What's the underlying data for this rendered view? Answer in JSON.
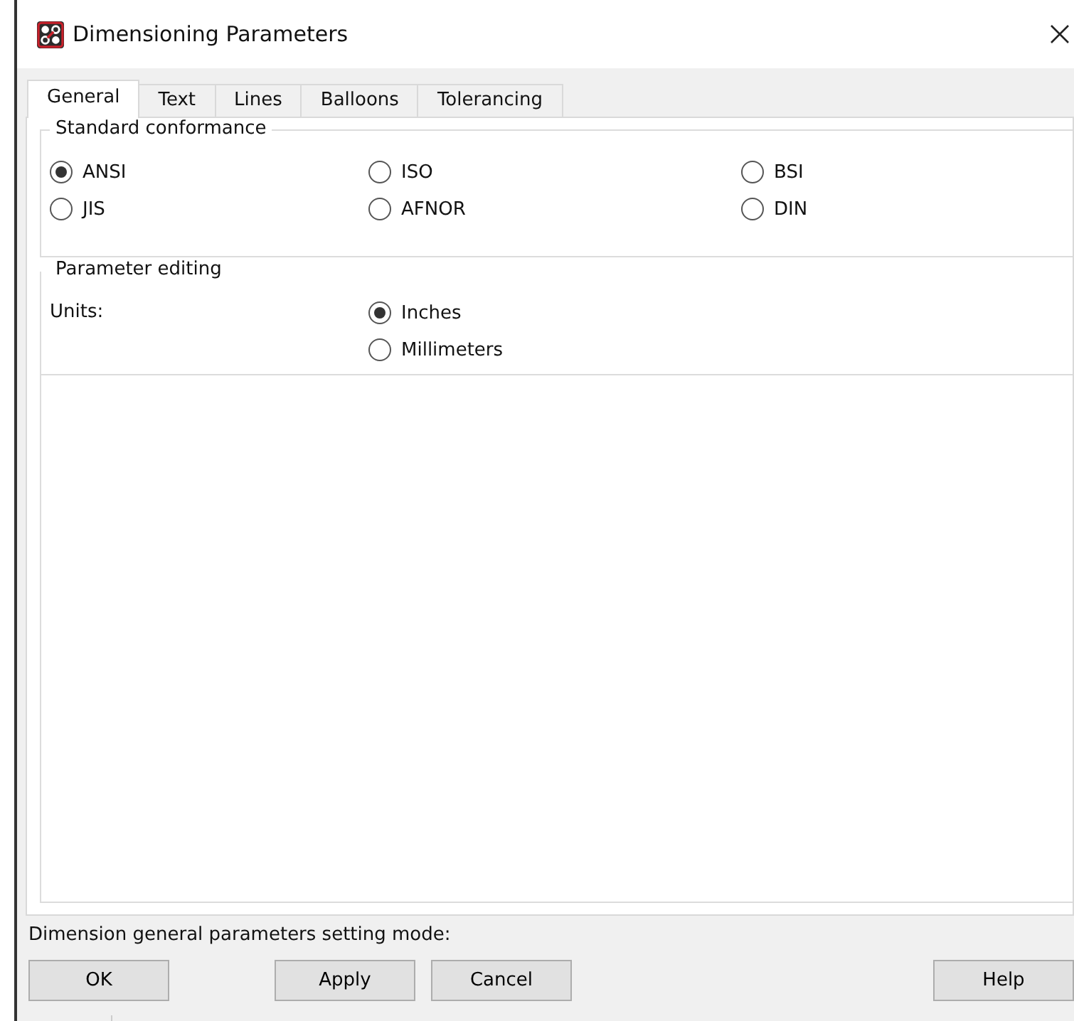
{
  "window": {
    "title": "Dimensioning Parameters"
  },
  "tabs": [
    {
      "label": "General",
      "selected": true
    },
    {
      "label": "Text",
      "selected": false
    },
    {
      "label": "Lines",
      "selected": false
    },
    {
      "label": "Balloons",
      "selected": false
    },
    {
      "label": "Tolerancing",
      "selected": false
    }
  ],
  "groups": [
    {
      "title": "Standard conformance",
      "kind": "grid",
      "options": [
        {
          "label": "ANSI",
          "selected": true
        },
        {
          "label": "ISO",
          "selected": false
        },
        {
          "label": "BSI",
          "selected": false
        },
        {
          "label": "JIS",
          "selected": false
        },
        {
          "label": "AFNOR",
          "selected": false
        },
        {
          "label": "DIN",
          "selected": false
        }
      ]
    },
    {
      "title": "Parameter editing",
      "kind": "field",
      "label": "Units:",
      "options": [
        {
          "label": "Inches",
          "selected": true
        },
        {
          "label": "Millimeters",
          "selected": false
        }
      ]
    }
  ],
  "status_text": "Dimension general parameters setting mode:",
  "buttons": [
    {
      "label": "OK"
    },
    {
      "label": "Apply"
    },
    {
      "label": "Cancel"
    },
    {
      "label": "Help"
    }
  ]
}
